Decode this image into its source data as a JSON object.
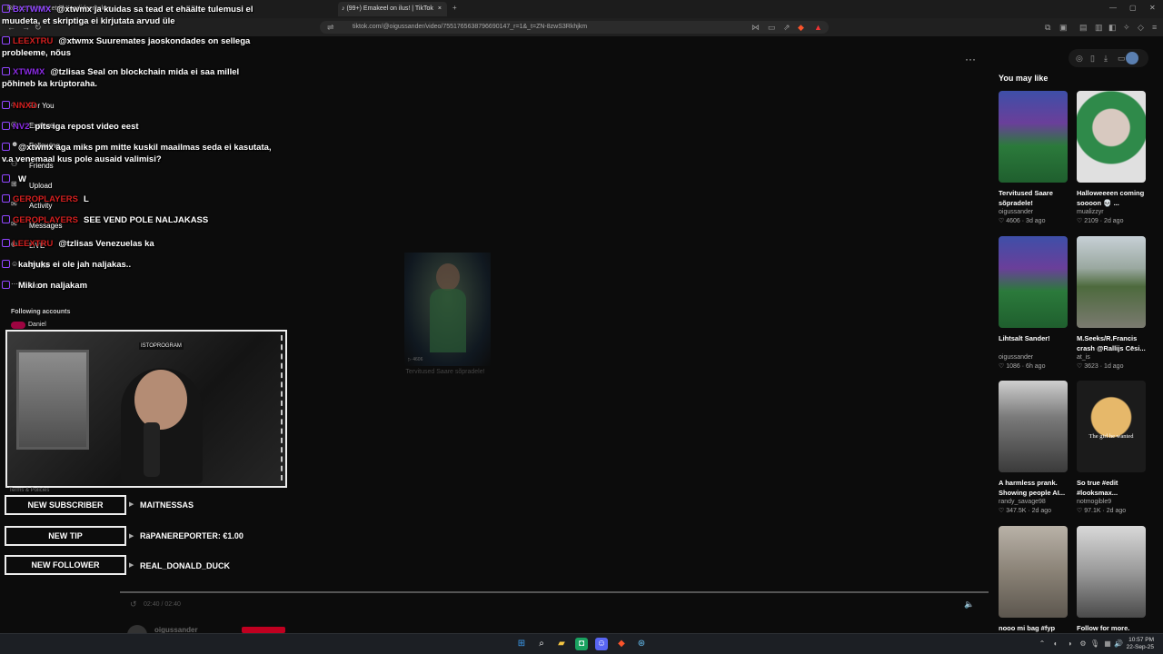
{
  "browser": {
    "tabs": [
      {
        "title": "Rõuge Neimmeetrid Kandideeritakse…"
      },
      {
        "title": "(99+) Emakeel on ilus! | TikTok"
      }
    ],
    "url": "tiktok.com/@oigussander/video/7551765638796690147_r=1&_t=ZN-8zwS3Rkhjkm"
  },
  "sidebar": {
    "items": [
      {
        "label": "For You",
        "icon": "home-icon"
      },
      {
        "label": "Explore",
        "icon": "compass-icon"
      },
      {
        "label": "Following",
        "icon": "users-icon"
      },
      {
        "label": "Friends",
        "icon": "friends-icon"
      },
      {
        "label": "Upload",
        "icon": "plus-icon"
      },
      {
        "label": "Activity",
        "icon": "bell-icon"
      },
      {
        "label": "Messages",
        "icon": "message-icon"
      },
      {
        "label": "LIVE",
        "icon": "live-icon"
      },
      {
        "label": "Profile",
        "icon": "profile-icon"
      },
      {
        "label": "More",
        "icon": "more-icon"
      }
    ],
    "following_header": "Following accounts",
    "following": [
      "Daniel"
    ],
    "footer": "Terms & Policies"
  },
  "chat": [
    {
      "user": "BXTWMX",
      "user_color": "#9146ff",
      "text": "@xtwmx ja kuidas sa tead et ehäälte tulemusi el muudeta, et skriptiga ei kirjutata arvud üle"
    },
    {
      "user": "LEEXTRU",
      "user_color": "#d21f1f",
      "text": "@xtwmx Suuremates jaoskondades on sellega probleeme, nõus"
    },
    {
      "user": "XTWMX",
      "user_color": "#8a2be2",
      "text": "@tzlisas Seal on blockchain mida ei saa millel põhineb ka krüptoraha."
    },
    {
      "user": "NNXD",
      "user_color": "#d21f1f",
      "text": ""
    },
    {
      "user": "NV2",
      "user_color": "#8a2be2",
      "text": "pits iga repost video eest"
    },
    {
      "user": "",
      "user_color": "#1e90ff",
      "text": "@xtwmx aga miks pm mitte kuskil maailmas seda ei kasutata, v.a venemaal kus pole ausaid valimisi?"
    },
    {
      "user": "",
      "user_color": "#1e4fd2",
      "text": "W"
    },
    {
      "user": "GEROPLAYERS",
      "user_color": "#d21f1f",
      "text": "L"
    },
    {
      "user": "GEROPLAYERS",
      "user_color": "#d21f1f",
      "text": "SEE VEND POLE NALJAKASS"
    },
    {
      "user": "LEEXTRU",
      "user_color": "#d21f1f",
      "text": "@tzlisas Venezuelas ka"
    },
    {
      "user": "",
      "user_color": "#1e4fd2",
      "text": "kahjuks ei ole jah naljakas.."
    },
    {
      "user": "",
      "user_color": "#1e4fd2",
      "text": "Miki on naljakam"
    }
  ],
  "webcam": {
    "label": "ISTOPROGRAM"
  },
  "alerts": [
    {
      "label": "NEW SUBSCRIBER",
      "value": "MAITNESSAS"
    },
    {
      "label": "NEW TIP",
      "value": "RäPANEREPORTER: €1.00"
    },
    {
      "label": "NEW FOLLOWER",
      "value": "REAL_DONALD_DUCK"
    }
  ],
  "video": {
    "caption": "Tervitused Saare sõpradele!",
    "views": "4606",
    "time": "02:40 / 02:40",
    "author": "oigussander",
    "progress_percent": 100
  },
  "feed": {
    "title": "You may like",
    "items": [
      {
        "title": "Tervitused Saare sõpradele!",
        "author": "oigussander",
        "likes": "4606",
        "age": "3d ago",
        "thumb": "person-green-jersey",
        "overlay": ""
      },
      {
        "title": "Halloweeeen coming soooon 💀 ...",
        "author": "mualizzyr",
        "likes": "2109",
        "age": "2d ago",
        "thumb": "halloween-makeup",
        "overlay": ""
      },
      {
        "title": "Lihtsalt Sander!",
        "author": "oigussander",
        "likes": "1086",
        "age": "6h ago",
        "thumb": "person-green-jersey",
        "overlay": ""
      },
      {
        "title": "M.Seeks/R.Francis crash @Rallijs Cēsi...",
        "author": "at_is",
        "likes": "3623",
        "age": "1d ago",
        "thumb": "rally-road",
        "overlay": ""
      },
      {
        "title": "A harmless prank. Showing people AI...",
        "author": "randy_savage98",
        "likes": "347.5K",
        "age": "2d ago",
        "thumb": "gym-prank",
        "overlay": ""
      },
      {
        "title": "So true #edit #looksmax...",
        "author": "notmogible9",
        "likes": "97.1K",
        "age": "2d ago",
        "thumb": "blonde-girl",
        "overlay": "The girl he wanted"
      },
      {
        "title": "nooo mi bag #fyp",
        "author": "",
        "likes": "",
        "age": "",
        "thumb": "street-crowd",
        "overlay": ""
      },
      {
        "title": "Follow for more.",
        "author": "",
        "likes": "",
        "age": "",
        "thumb": "hooded-girl",
        "overlay": ""
      }
    ]
  },
  "taskbar": {
    "time": "10:57 PM",
    "date": "22-Sep-25"
  }
}
